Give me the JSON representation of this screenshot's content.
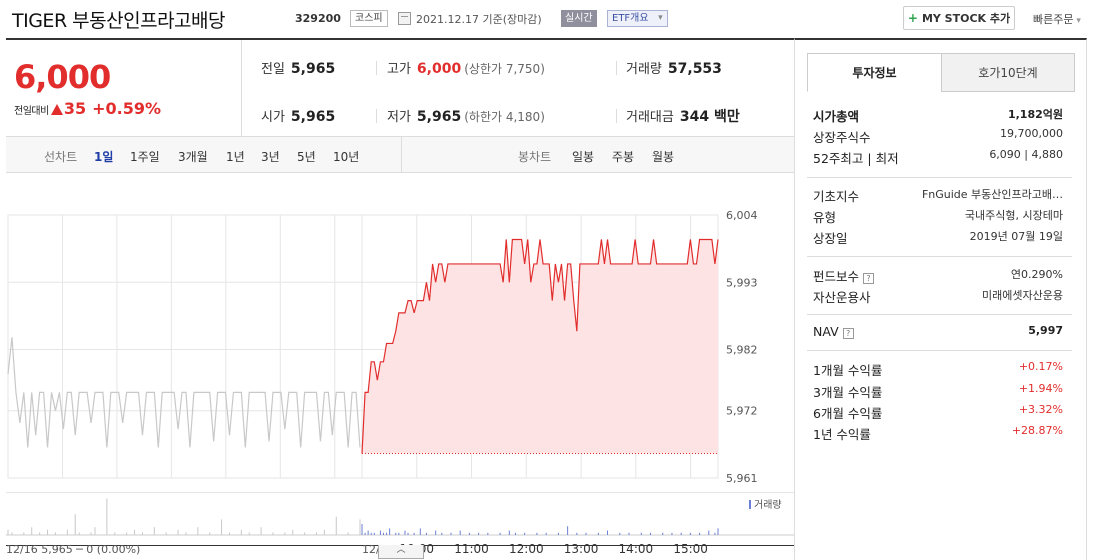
{
  "header": {
    "name": "TIGER 부동산인프라고배당",
    "code": "329200",
    "market": "코스피",
    "base_date": "2021.12.17  기준(장마감)",
    "realtime": "실시간",
    "etf_overview": "ETF개요",
    "mystock": "MY STOCK 추가",
    "quick_order": "빠른주문"
  },
  "quote": {
    "price": "6,000",
    "change_label": "전일대비",
    "change": "35",
    "change_rate": "+0.59%",
    "prev_label": "전일",
    "prev": "5,965",
    "open_label": "시가",
    "open": "5,965",
    "high_label": "고가",
    "high": "6,000",
    "upper_limit": "(상한가 7,750)",
    "low_label": "저가",
    "low": "5,965",
    "lower_limit": "(하한가 4,180)",
    "volume_label": "거래량",
    "volume": "57,553",
    "amount_label": "거래대금",
    "amount": "344 백만"
  },
  "period_bar": {
    "line_label": "선차트",
    "line_periods": [
      "1일",
      "1주일",
      "3개월",
      "1년",
      "3년",
      "5년",
      "10년"
    ],
    "active": "1일",
    "candle_label": "봉차트",
    "candle_periods": [
      "일봉",
      "주봉",
      "월봉"
    ]
  },
  "chart_data": {
    "type": "line",
    "y_ticks": [
      "6,004",
      "5,993",
      "5,982",
      "5,972",
      "5,961"
    ],
    "ylim": [
      5961,
      6004
    ],
    "prev_day": {
      "label": "12/16  5,965 ─ 0 (0.00%)",
      "values": [
        5978,
        5984,
        5975,
        5970,
        5975,
        5966,
        5975,
        5968,
        5975,
        5975,
        5966,
        5975,
        5972,
        5975,
        5969,
        5975,
        5975,
        5968,
        5975,
        5975,
        5975,
        5970,
        5975,
        5975,
        5975,
        5966,
        5975,
        5975,
        5975,
        5970,
        5975,
        5975,
        5975,
        5975,
        5968,
        5975,
        5975,
        5975,
        5966,
        5975,
        5975,
        5975,
        5975,
        5969,
        5975,
        5975,
        5966,
        5975,
        5975,
        5975,
        5975,
        5975,
        5967,
        5975,
        5975,
        5975,
        5968,
        5975,
        5975,
        5975,
        5966,
        5975,
        5975,
        5975,
        5975,
        5975,
        5967,
        5975,
        5975,
        5975,
        5969,
        5975,
        5975,
        5975,
        5966,
        5975,
        5975,
        5975,
        5975,
        5967,
        5975,
        5975,
        5968,
        5975,
        5975,
        5975,
        5966,
        5975,
        5975,
        5966
      ]
    },
    "today": {
      "date_label": "12/17",
      "time_labels": [
        "10:00",
        "11:00",
        "12:00",
        "13:00",
        "14:00",
        "15:00"
      ],
      "baseline": 5965,
      "values": [
        5965,
        5975,
        5975,
        5980,
        5980,
        5977,
        5980,
        5980,
        5983,
        5983,
        5983,
        5985,
        5988,
        5988,
        5988,
        5990,
        5990,
        5988,
        5990,
        5990,
        5990,
        5993,
        5990,
        5996,
        5993,
        5996,
        5996,
        5993,
        5996,
        5996,
        5996,
        5996,
        5996,
        5996,
        5996,
        5996,
        5996,
        5996,
        5996,
        5996,
        5996,
        5996,
        5996,
        5996,
        5996,
        5996,
        5993,
        6000,
        5993,
        6000,
        6000,
        6000,
        6000,
        5996,
        6000,
        5993,
        5996,
        5996,
        6000,
        5996,
        5996,
        5996,
        5990,
        5996,
        5993,
        5996,
        5990,
        5996,
        5996,
        5990,
        5985,
        5996,
        5996,
        5996,
        5996,
        5996,
        5996,
        5996,
        6000,
        5996,
        6000,
        5996,
        5996,
        5996,
        5996,
        5996,
        5996,
        5996,
        5996,
        6000,
        5996,
        5996,
        5996,
        5996,
        5996,
        6000,
        5996,
        5996,
        5996,
        5996,
        5996,
        5996,
        5996,
        5996,
        5996,
        5996,
        5996,
        6000,
        5996,
        5996,
        6000,
        6000,
        6000,
        6000,
        6000,
        5996,
        6000
      ]
    },
    "volume_legend": "거래량",
    "volume_prev": [
      2,
      1,
      0,
      0,
      1,
      0,
      3,
      0,
      1,
      0,
      2,
      0,
      1,
      0,
      0,
      2,
      0,
      8,
      1,
      0,
      0,
      1,
      3,
      0,
      0,
      14,
      0,
      1,
      0,
      0,
      1,
      0,
      2,
      0,
      1,
      0,
      0,
      3,
      0,
      0,
      1,
      0,
      0,
      2,
      0,
      1,
      0,
      0,
      3,
      0,
      0,
      1,
      0,
      0,
      6,
      0,
      1,
      0,
      0,
      2,
      0,
      1,
      0,
      0,
      3,
      0,
      0,
      1,
      0,
      0,
      1,
      0,
      2,
      0,
      0,
      1,
      0,
      0,
      1,
      0,
      2,
      0,
      0,
      7,
      0,
      0,
      1,
      0,
      0,
      6
    ],
    "volume_today": [
      5,
      1,
      2,
      1,
      1,
      0,
      2,
      1,
      1,
      3,
      0,
      1,
      1,
      0,
      2,
      1,
      0,
      1,
      0,
      3,
      0,
      1,
      0,
      0,
      2,
      0,
      1,
      0,
      0,
      1,
      0,
      0,
      2,
      0,
      0,
      1,
      0,
      0,
      1,
      0,
      0,
      1,
      0,
      0,
      0,
      1,
      0,
      0,
      2,
      0,
      1,
      0,
      0,
      1,
      0,
      0,
      0,
      1,
      0,
      0,
      1,
      0,
      0,
      0,
      1,
      0,
      0,
      4,
      0,
      0,
      1,
      0,
      0,
      1,
      0,
      0,
      0,
      1,
      0,
      0,
      2,
      0,
      0,
      0,
      1,
      0,
      0,
      1,
      0,
      0,
      0,
      1,
      0,
      0,
      1,
      0,
      0,
      0,
      1,
      0,
      0,
      1,
      0,
      0,
      1,
      0,
      0,
      1,
      0,
      0,
      1,
      0,
      0,
      2,
      0,
      1,
      3
    ]
  },
  "info": {
    "tabs": [
      "투자정보",
      "호가10단계"
    ],
    "market_cap_label": "시가총액",
    "market_cap": "1,182억원",
    "shares_label": "상장주식수",
    "shares": "19,700,000",
    "w52_label": "52주최고 | 최저",
    "w52": "6,090 | 4,880",
    "index_label": "기초지수",
    "index": "FnGuide 부동산인프라고배…",
    "type_label": "유형",
    "type": "국내주식형, 시장테마",
    "listing_label": "상장일",
    "listing": "2019년 07월 19일",
    "fee_label": "펀드보수",
    "fee": "연0.290%",
    "manager_label": "자산운용사",
    "manager": "미래에셋자산운용",
    "nav_label": "NAV",
    "nav": "5,997",
    "ret1m_label": "1개월 수익률",
    "ret1m": "+0.17%",
    "ret3m_label": "3개월 수익률",
    "ret3m": "+1.94%",
    "ret6m_label": "6개월 수익률",
    "ret6m": "+3.32%",
    "ret1y_label": "1년 수익률",
    "ret1y": "+28.87%",
    "help_icon": "?"
  },
  "colors": {
    "up": "#e22d2d",
    "volume": "#6b7fd7",
    "grid": "#e6e6e6",
    "prev_line": "#c8c8c8"
  }
}
